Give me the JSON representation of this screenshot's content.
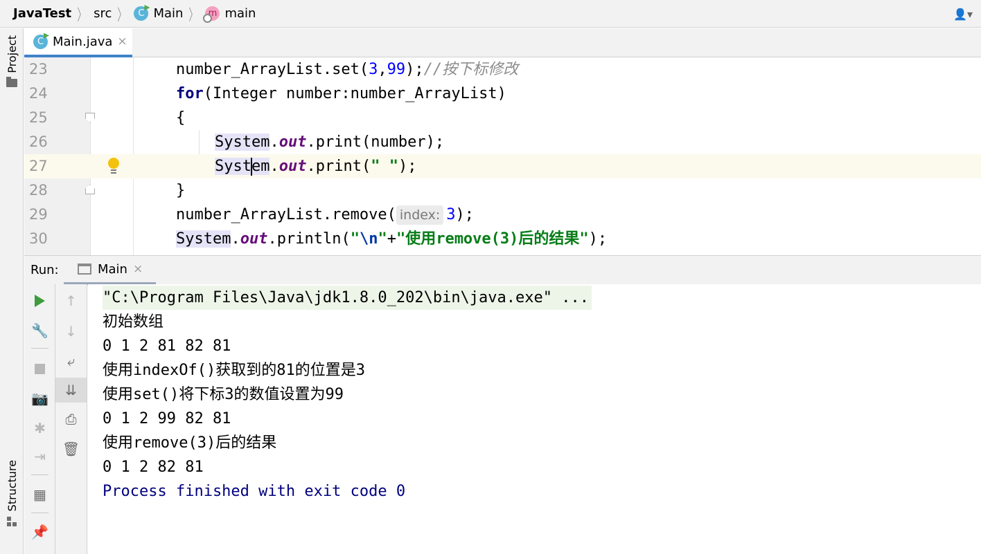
{
  "breadcrumb": {
    "project": "JavaTest",
    "folder": "src",
    "class_name": "Main",
    "class_icon_letter": "C",
    "method_name": "main",
    "method_icon_letter": "m"
  },
  "tool_windows": {
    "project_label": "Project",
    "structure_label": "Structure"
  },
  "editor_tab": {
    "file_name": "Main.java",
    "close_glyph": "×"
  },
  "editor": {
    "line_numbers": [
      "23",
      "24",
      "25",
      "26",
      "27",
      "28",
      "29",
      "30"
    ],
    "l23": {
      "a": "number_ArrayList.set(",
      "n1": "3",
      "c": ",",
      "n2": "99",
      "b": ");",
      "comment": "//按下标修改"
    },
    "l24": {
      "kw": "for",
      "rest": "(Integer number:number_ArrayList)"
    },
    "l25": {
      "text": "{"
    },
    "l26": {
      "cls": "System",
      "dot": ".",
      "field": "out",
      "rest": ".print(number);"
    },
    "l27": {
      "cls_a": "Syst",
      "cls_b": "em",
      "dot": ".",
      "field": "out",
      "rest1": ".print(",
      "str": "\" \"",
      "rest2": ");"
    },
    "l28": {
      "text": "}"
    },
    "l29": {
      "a": "number_ArrayList.remove(",
      "hint": "index:",
      "num": "3",
      "b": ");"
    },
    "l30": {
      "cls": "System",
      "dot": ".",
      "field": "out",
      "rest1": ".println(",
      "s1": "\"",
      "esc": "\\n",
      "s2": "\"",
      "plus": "+",
      "s3": "\"使用remove(3)后的结果\"",
      "rest2": ");"
    }
  },
  "run_panel": {
    "label": "Run:",
    "tab_name": "Main",
    "close_glyph": "×",
    "output": [
      "\"C:\\Program Files\\Java\\jdk1.8.0_202\\bin\\java.exe\" ...",
      "初始数组",
      "0 1 2 81 82 81",
      "使用indexOf()获取到的81的位置是3",
      "使用set()将下标3的数值设置为99",
      "0 1 2 99 82 81",
      "使用remove(3)后的结果",
      "0 1 2 82 81",
      "Process finished with exit code 0"
    ]
  },
  "icons": {
    "user": "👤",
    "dropdown": "▾",
    "up": "↑",
    "down": "↓",
    "wrap": "⤶",
    "scroll_end": "⇊",
    "print": "⎙",
    "trash": "🗑",
    "wrench": "🔧",
    "camera": "📷",
    "bug": "✱",
    "login": "⇥",
    "layout": "▦",
    "pin": "📌"
  },
  "colors": {
    "keyword": "#000080",
    "number": "#0000ff",
    "string": "#067d17",
    "field": "#660e7a",
    "comment": "#8c8c8c",
    "tab_accent": "#4083c9",
    "run_green": "#3e9c3c",
    "exit_text": "#00007f"
  }
}
